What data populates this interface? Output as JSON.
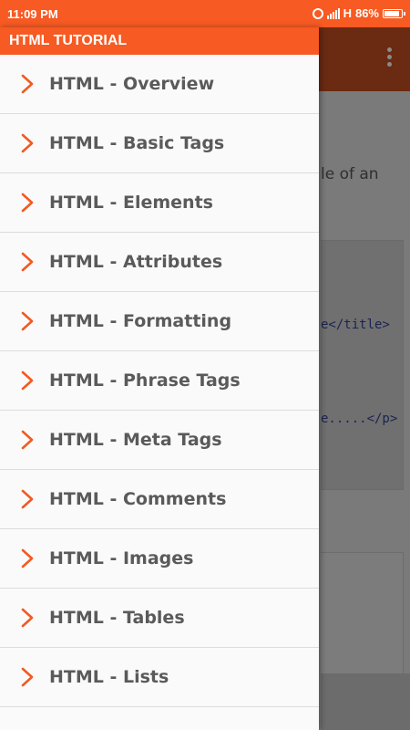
{
  "status_bar": {
    "time": "11:09 PM",
    "network": "H",
    "battery": "86%"
  },
  "drawer": {
    "title": "HTML TUTORIAL",
    "items": [
      {
        "label": "HTML - Overview"
      },
      {
        "label": "HTML - Basic Tags"
      },
      {
        "label": "HTML - Elements"
      },
      {
        "label": "HTML - Attributes"
      },
      {
        "label": "HTML - Formatting"
      },
      {
        "label": "HTML - Phrase Tags"
      },
      {
        "label": "HTML - Meta Tags"
      },
      {
        "label": "HTML - Comments"
      },
      {
        "label": "HTML - Images"
      },
      {
        "label": "HTML - Tables"
      },
      {
        "label": "HTML - Lists"
      }
    ]
  },
  "background_page": {
    "text_fragment": "le of an",
    "code_lines": [
      "e</title>",
      "e.....</p>"
    ]
  },
  "colors": {
    "accent": "#f75a22",
    "chevron": "#f25a22",
    "item_text": "#5a5a5a"
  }
}
